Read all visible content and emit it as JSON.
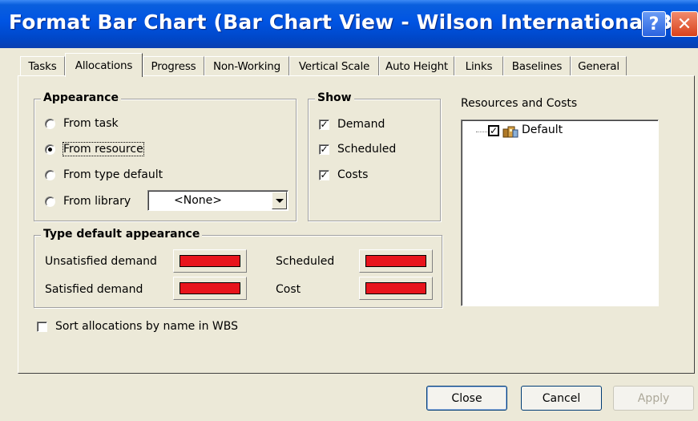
{
  "window": {
    "title": "Format Bar Chart (Bar Chart View - Wilson International B...",
    "help_glyph": "?",
    "close_glyph": "✕"
  },
  "tabs": [
    {
      "label": "Tasks",
      "active": false
    },
    {
      "label": "Allocations",
      "active": true
    },
    {
      "label": "Progress",
      "active": false
    },
    {
      "label": "Non-Working",
      "active": false
    },
    {
      "label": "Vertical Scale",
      "active": false
    },
    {
      "label": "Auto Height",
      "active": false
    },
    {
      "label": "Links",
      "active": false
    },
    {
      "label": "Baselines",
      "active": false
    },
    {
      "label": "General",
      "active": false
    }
  ],
  "appearance": {
    "title": "Appearance",
    "options": [
      {
        "label": "From task",
        "selected": false
      },
      {
        "label": "From resource",
        "selected": true
      },
      {
        "label": "From type default",
        "selected": false
      },
      {
        "label": "From library",
        "selected": false
      }
    ],
    "library_value": "<None>"
  },
  "show": {
    "title": "Show",
    "items": [
      {
        "label": "Demand",
        "checked": true
      },
      {
        "label": "Scheduled",
        "checked": true
      },
      {
        "label": "Costs",
        "checked": true
      }
    ],
    "check_glyph": "✓"
  },
  "type_default": {
    "title": "Type default appearance",
    "items": [
      {
        "label": "Unsatisfied demand",
        "color": "#e8141c"
      },
      {
        "label": "Satisfied demand",
        "color": "#e8141c"
      },
      {
        "label": "Scheduled",
        "color": "#e8141c"
      },
      {
        "label": "Cost",
        "color": "#e8141c"
      }
    ]
  },
  "resources": {
    "title": "Resources and Costs",
    "tree": [
      {
        "label": "Default",
        "checked": true,
        "icon": "resource-group-icon"
      }
    ]
  },
  "sort": {
    "label": "Sort allocations by name in WBS",
    "checked": false
  },
  "buttons": {
    "close": "Close",
    "cancel": "Cancel",
    "apply": "Apply"
  }
}
